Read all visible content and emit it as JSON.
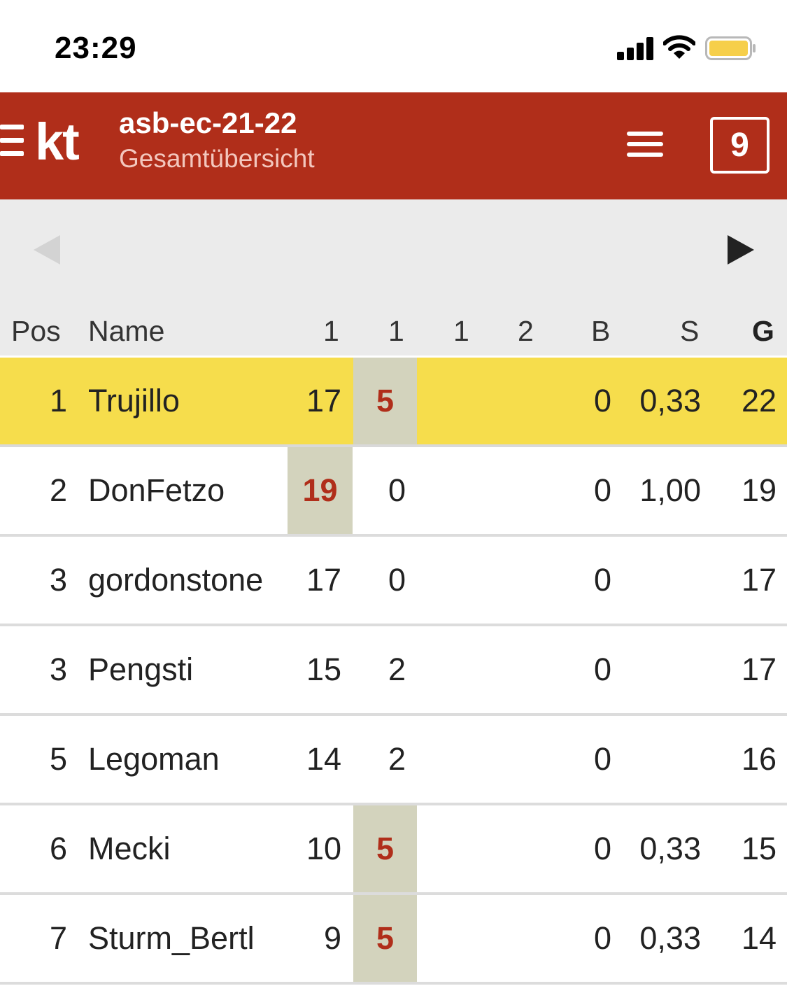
{
  "status_bar": {
    "time": "23:29",
    "icons": [
      "signal-icon",
      "wifi-icon",
      "battery-icon"
    ],
    "battery_color": "#f6cf4a"
  },
  "header": {
    "logo": "kt",
    "title": "asb-ec-21-22",
    "subtitle": "Gesamtübersicht",
    "round_number": "9",
    "color": "#b02e1a"
  },
  "nav": {
    "prev_icon": "triangle-left-icon",
    "next_icon": "triangle-right-icon"
  },
  "table": {
    "columns": [
      "Pos",
      "Name",
      "1",
      "1",
      "1",
      "2",
      "B",
      "S",
      "G"
    ],
    "rows": [
      {
        "pos": "1",
        "name": "Trujillo",
        "c1": "17",
        "c2": "5",
        "c3": "",
        "c4": "",
        "b": "0",
        "s": "0,33",
        "g": "22"
      },
      {
        "pos": "2",
        "name": "DonFetzo",
        "c1": "19",
        "c2": "0",
        "c3": "",
        "c4": "",
        "b": "0",
        "s": "1,00",
        "g": "19"
      },
      {
        "pos": "3",
        "name": "gordonstone",
        "c1": "17",
        "c2": "0",
        "c3": "",
        "c4": "",
        "b": "0",
        "s": "",
        "g": "17"
      },
      {
        "pos": "3",
        "name": "Pengsti",
        "c1": "15",
        "c2": "2",
        "c3": "",
        "c4": "",
        "b": "0",
        "s": "",
        "g": "17"
      },
      {
        "pos": "5",
        "name": "Legoman",
        "c1": "14",
        "c2": "2",
        "c3": "",
        "c4": "",
        "b": "0",
        "s": "",
        "g": "16"
      },
      {
        "pos": "6",
        "name": "Mecki",
        "c1": "10",
        "c2": "5",
        "c3": "",
        "c4": "",
        "b": "0",
        "s": "0,33",
        "g": "15"
      },
      {
        "pos": "7",
        "name": "Sturm_Bertl",
        "c1": "9",
        "c2": "5",
        "c3": "",
        "c4": "",
        "b": "0",
        "s": "0,33",
        "g": "14"
      }
    ]
  },
  "colors": {
    "leader_row": "#f6dd4c",
    "highlight_cell": "#d3d3bd",
    "highlight_text": "#b02e1a"
  }
}
